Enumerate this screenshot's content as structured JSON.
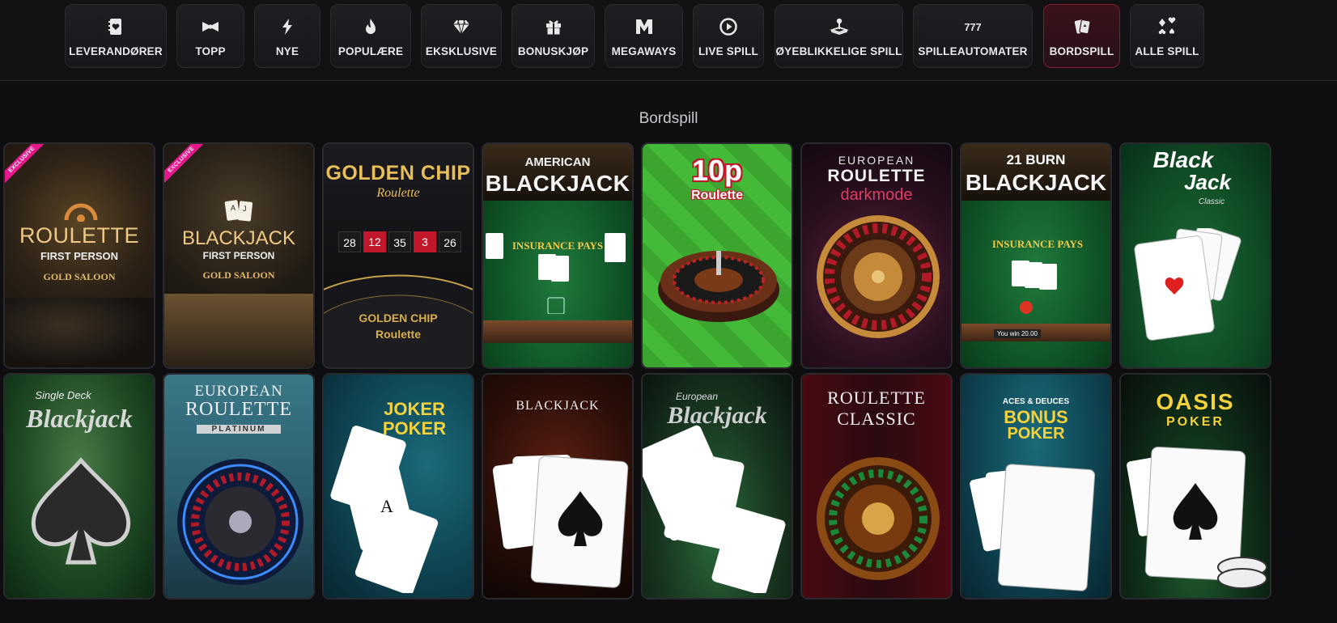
{
  "nav": {
    "tabs": [
      {
        "label": "LEVERANDØRER",
        "icon": "provider-book-icon",
        "active": false
      },
      {
        "label": "TOPP",
        "icon": "bow-tie-icon",
        "active": false
      },
      {
        "label": "NYE",
        "icon": "lightning-icon",
        "active": false
      },
      {
        "label": "POPULÆRE",
        "icon": "flame-icon",
        "active": false
      },
      {
        "label": "EKSKLUSIVE",
        "icon": "diamond-icon",
        "active": false
      },
      {
        "label": "BONUSKJØP",
        "icon": "gift-icon",
        "active": false
      },
      {
        "label": "MEGAWAYS",
        "icon": "megaways-m-icon",
        "active": false
      },
      {
        "label": "LIVE SPILL",
        "icon": "play-circle-icon",
        "active": false
      },
      {
        "label": "ØYEBLIKKELIGE SPILL",
        "icon": "joystick-icon",
        "active": false
      },
      {
        "label": "SPILLEAUTOMATER",
        "icon": "slot-777-icon",
        "active": false
      },
      {
        "label": "BORDSPILL",
        "icon": "playing-cards-icon",
        "active": true
      },
      {
        "label": "ALLE SPILL",
        "icon": "card-suits-icon",
        "active": false
      }
    ],
    "colors": {
      "active_border": "#8a1a2c",
      "active_bg": "#3a1119"
    }
  },
  "section": {
    "title": "Bordspill"
  },
  "games": [
    {
      "name": "Roulette First Person Gold Saloon",
      "line1": "ROULETTE",
      "line2": "FIRST PERSON",
      "line3": "GOLD SALOON",
      "badge": "EXCLUSIVE"
    },
    {
      "name": "Blackjack First Person Gold Saloon",
      "line1": "BLACKJACK",
      "line2": "FIRST PERSON",
      "line3": "GOLD SALOON",
      "badge": "EXCLUSIVE"
    },
    {
      "name": "Golden Chip Roulette",
      "line1": "GOLDEN CHIP",
      "line2": "Roulette",
      "line3": "GOLDEN CHIP Roulette",
      "wheel_numbers": [
        "28",
        "12",
        "35",
        "3",
        "26"
      ]
    },
    {
      "name": "American Blackjack",
      "line1": "AMERICAN",
      "line2": "BLACKJACK",
      "line3": "INSURANCE PAYS"
    },
    {
      "name": "10p Roulette",
      "line1": "10p",
      "line2": "Roulette"
    },
    {
      "name": "European Roulette darkmode",
      "line1": "EUROPEAN",
      "line2": "ROULETTE",
      "line3": "darkmode"
    },
    {
      "name": "21 Burn Blackjack",
      "line1": "21 BURN",
      "line2": "BLACKJACK",
      "line3": "You win 20.00"
    },
    {
      "name": "Black Jack Classic",
      "line1": "Black",
      "line2": "Jack",
      "line3": "Classic"
    },
    {
      "name": "Single Deck Blackjack",
      "line1": "Single Deck",
      "line2": "Blackjack"
    },
    {
      "name": "European Roulette Platinum",
      "line1": "EUROPEAN",
      "line2": "ROULETTE",
      "line3": "PLATINUM"
    },
    {
      "name": "Joker Poker",
      "line1": "JOKER",
      "line2": "POKER"
    },
    {
      "name": "BlackJack",
      "line1": "BLACKJACK"
    },
    {
      "name": "European Blackjack",
      "line1": "European",
      "line2": "Blackjack"
    },
    {
      "name": "Roulette Classic",
      "line1": "ROULETTE",
      "line2": "CLASSIC"
    },
    {
      "name": "Aces & Deuces Bonus Poker",
      "line1": "ACES & DEUCES",
      "line2": "BONUS",
      "line3": "POKER"
    },
    {
      "name": "Oasis Poker",
      "line1": "OASIS",
      "line2": "POKER"
    }
  ]
}
